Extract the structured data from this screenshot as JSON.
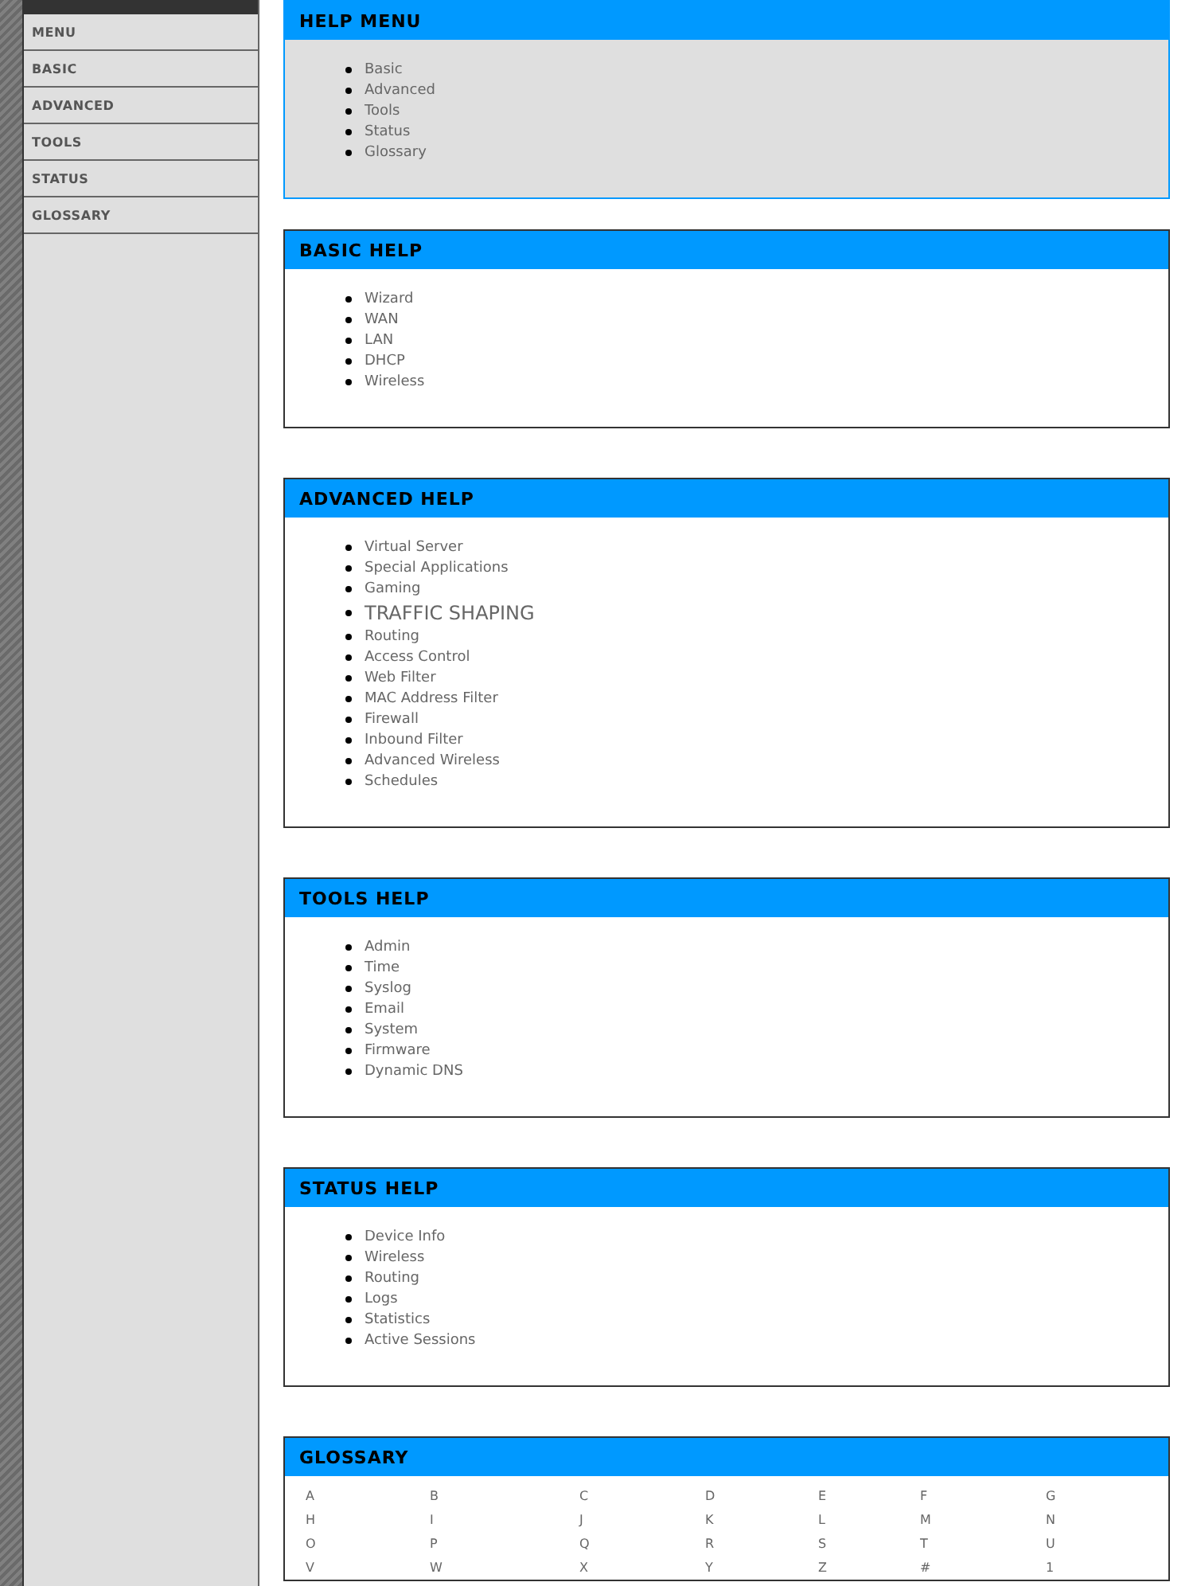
{
  "sidebar": {
    "items": [
      {
        "label": "MENU"
      },
      {
        "label": "BASIC"
      },
      {
        "label": "ADVANCED"
      },
      {
        "label": "TOOLS"
      },
      {
        "label": "STATUS"
      },
      {
        "label": "GLOSSARY"
      }
    ]
  },
  "sections": [
    {
      "title": "HELP MENU",
      "shaded": true,
      "items": [
        {
          "label": "Basic",
          "kind": "normal"
        },
        {
          "label": "Advanced",
          "kind": "normal"
        },
        {
          "label": "Tools",
          "kind": "normal"
        },
        {
          "label": "Status",
          "kind": "normal"
        },
        {
          "label": "Glossary",
          "kind": "normal"
        }
      ]
    },
    {
      "title": "BASIC HELP",
      "shaded": false,
      "items": [
        {
          "label": "Wizard",
          "kind": "normal"
        },
        {
          "label": "WAN",
          "kind": "normal"
        },
        {
          "label": "LAN",
          "kind": "normal"
        },
        {
          "label": "DHCP",
          "kind": "normal"
        },
        {
          "label": "Wireless",
          "kind": "normal"
        }
      ]
    },
    {
      "title": "ADVANCED HELP",
      "shaded": false,
      "items": [
        {
          "label": "Virtual Server",
          "kind": "normal"
        },
        {
          "label": "Special Applications",
          "kind": "normal"
        },
        {
          "label": "Gaming",
          "kind": "normal"
        },
        {
          "label": "TRAFFIC SHAPING",
          "kind": "large"
        },
        {
          "label": "Routing",
          "kind": "normal"
        },
        {
          "label": "Access Control",
          "kind": "normal"
        },
        {
          "label": "Web Filter",
          "kind": "normal"
        },
        {
          "label": "MAC Address Filter",
          "kind": "normal"
        },
        {
          "label": "Firewall",
          "kind": "normal"
        },
        {
          "label": "Inbound Filter",
          "kind": "normal"
        },
        {
          "label": "Advanced Wireless",
          "kind": "normal"
        },
        {
          "label": "Schedules",
          "kind": "normal"
        }
      ]
    },
    {
      "title": "TOOLS HELP",
      "shaded": false,
      "items": [
        {
          "label": "Admin",
          "kind": "normal"
        },
        {
          "label": "Time",
          "kind": "normal"
        },
        {
          "label": "Syslog",
          "kind": "normal"
        },
        {
          "label": "Email",
          "kind": "normal"
        },
        {
          "label": "System",
          "kind": "normal"
        },
        {
          "label": "Firmware",
          "kind": "normal"
        },
        {
          "label": "Dynamic DNS",
          "kind": "normal"
        }
      ]
    },
    {
      "title": "STATUS HELP",
      "shaded": false,
      "items": [
        {
          "label": "Device Info",
          "kind": "normal"
        },
        {
          "label": "Wireless",
          "kind": "normal"
        },
        {
          "label": "Routing",
          "kind": "normal"
        },
        {
          "label": "Logs",
          "kind": "normal"
        },
        {
          "label": "Statistics",
          "kind": "normal"
        },
        {
          "label": "Active Sessions",
          "kind": "normal"
        }
      ]
    }
  ],
  "glossary": {
    "title": "GLOSSARY",
    "letters": [
      "A",
      "B",
      "C",
      "D",
      "E",
      "F",
      "G",
      "H",
      "I",
      "J",
      "K",
      "L",
      "M",
      "N",
      "O",
      "P",
      "Q",
      "R",
      "S",
      "T",
      "U",
      "V",
      "W",
      "X",
      "Y",
      "Z",
      "#",
      "1"
    ]
  }
}
